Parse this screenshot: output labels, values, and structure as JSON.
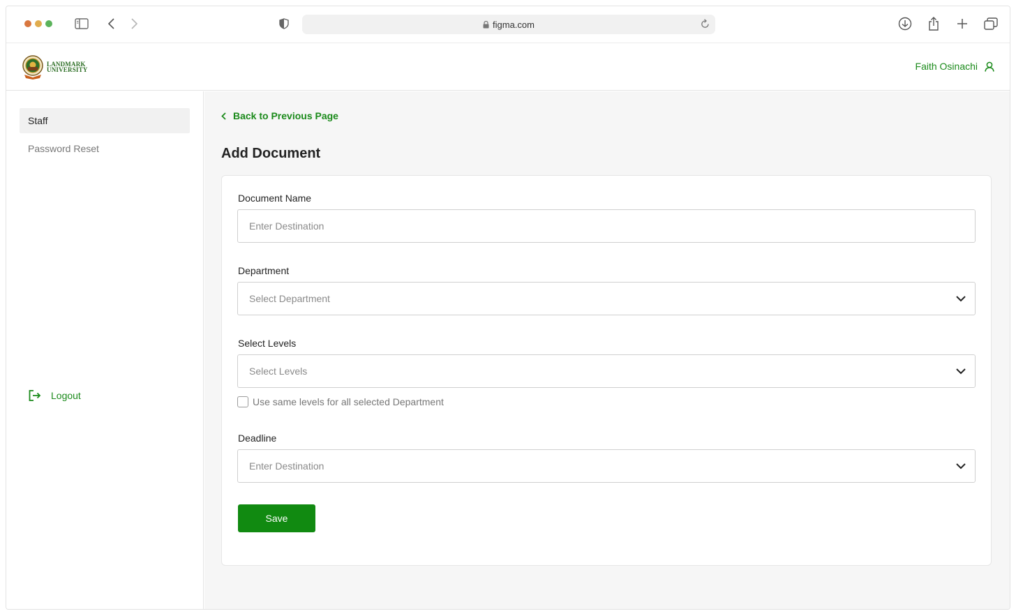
{
  "browser": {
    "url": "figma.com"
  },
  "header": {
    "logo_line1": "LANDMARK",
    "logo_line2": "UNIVERSITY",
    "user_name": "Faith Osinachi"
  },
  "sidebar": {
    "items": [
      {
        "label": "Staff",
        "active": true
      },
      {
        "label": "Password Reset",
        "active": false
      }
    ],
    "logout_label": "Logout"
  },
  "main": {
    "back_label": "Back to Previous Page",
    "title": "Add Document",
    "form": {
      "document_name": {
        "label": "Document Name",
        "placeholder": "Enter Destination"
      },
      "department": {
        "label": "Department",
        "placeholder": "Select Department"
      },
      "levels": {
        "label": "Select Levels",
        "placeholder": "Select Levels"
      },
      "same_levels_checkbox": {
        "label": "Use same levels for all selected Department",
        "checked": false
      },
      "deadline": {
        "label": "Deadline",
        "placeholder": "Enter Destination"
      },
      "save_label": "Save"
    }
  },
  "colors": {
    "accent_green": "#118a11",
    "traffic_red": "#e0774a",
    "traffic_yellow": "#e0b24a",
    "traffic_green": "#5cb55c"
  }
}
